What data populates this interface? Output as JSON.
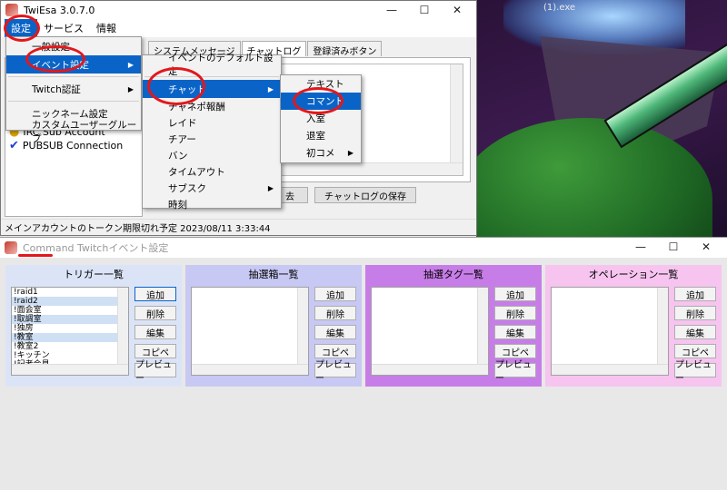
{
  "background": {
    "exe_text": "(1).exe"
  },
  "window1": {
    "title": "TwiEsa 3.0.7.0",
    "controls": {
      "minimize": "—",
      "maximize": "☐",
      "close": "✕"
    },
    "menubar": [
      {
        "label": "設定"
      },
      {
        "label": "サービス"
      },
      {
        "label": "情報"
      }
    ],
    "tabs": [
      {
        "label": "システムメッセージ"
      },
      {
        "label": "チャットログ"
      },
      {
        "label": "登録済みボタン"
      }
    ],
    "connections": [
      {
        "label": "IRC Sub Account"
      },
      {
        "label": "PUBSUB Connection"
      }
    ],
    "buttons": {
      "clear_suffix": "去",
      "save_log": "チャットログの保存"
    },
    "status": "メインアカウントのトークン期限切れ予定 2023/08/11 3:33:44"
  },
  "menu1": {
    "items": [
      {
        "label": "一般設定"
      },
      {
        "label": "イベント設定",
        "sub": "▶"
      },
      {
        "label": "Twitch認証",
        "sub": "▶"
      },
      {
        "label": "ニックネーム設定"
      },
      {
        "label": "カスタムユーザーグループ"
      }
    ]
  },
  "menu2": {
    "items": [
      {
        "label": "イベントのデフォルト設定"
      },
      {
        "label": "チャット",
        "sub": "▶"
      },
      {
        "label": "チャネポ報酬"
      },
      {
        "label": "レイド"
      },
      {
        "label": "チアー"
      },
      {
        "label": "バン"
      },
      {
        "label": "タイムアウト"
      },
      {
        "label": "サブスク",
        "sub": "▶"
      },
      {
        "label": "時刻"
      }
    ]
  },
  "menu3": {
    "items": [
      {
        "label": "テキスト"
      },
      {
        "label": "コマンド"
      },
      {
        "label": "入室"
      },
      {
        "label": "退室"
      },
      {
        "label": "初コメ",
        "sub": "▶"
      }
    ]
  },
  "window2": {
    "title": "Command Twitchイベント設定",
    "controls": {
      "minimize": "—",
      "maximize": "☐",
      "close": "✕"
    },
    "button_labels": [
      "追加",
      "削除",
      "編集",
      "コピペ",
      "プレビュー"
    ],
    "groups": [
      {
        "title": "トリガー一覧",
        "color": "#dbe4f7",
        "items": [
          "!raid1",
          "!raid2",
          "!面会室",
          "!取調室",
          "!独房",
          "!教室",
          "!教室2",
          "!キッチン",
          "!記者会見"
        ]
      },
      {
        "title": "抽選箱一覧",
        "color": "#c8c8f4",
        "items": []
      },
      {
        "title": "抽選タグ一覧",
        "color": "#c77de8",
        "items": []
      },
      {
        "title": "オペレーション一覧",
        "color": "#f6c4ef",
        "items": []
      }
    ]
  },
  "colors": {
    "accent": "#0a64c8",
    "annotation": "#e3171b"
  }
}
